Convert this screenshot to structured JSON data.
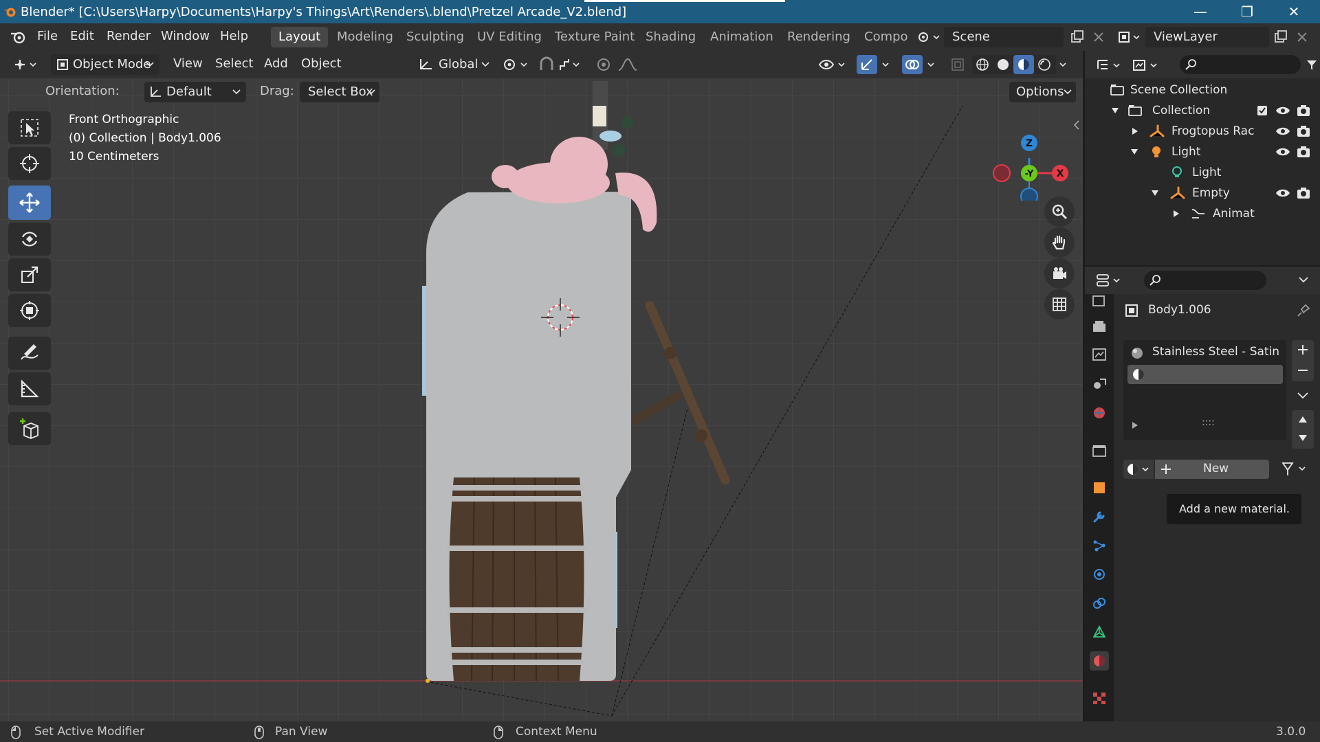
{
  "window": {
    "title": "Blender* [C:\\Users\\Harpy\\Documents\\Harpy's Things\\Art\\Renders\\.blend\\Pretzel Arcade_V2.blend]",
    "minimize": "—",
    "maximize": "❐",
    "close": "✕"
  },
  "menu": {
    "items": [
      "File",
      "Edit",
      "Render",
      "Window",
      "Help"
    ],
    "workspaces": [
      "Layout",
      "Modeling",
      "Sculpting",
      "UV Editing",
      "Texture Paint",
      "Shading",
      "Animation",
      "Rendering",
      "Compo"
    ],
    "active_workspace": "Layout",
    "scene": "Scene",
    "view_layer": "ViewLayer"
  },
  "viewport": {
    "mode": "Object Mode",
    "menus": [
      "View",
      "Select",
      "Add",
      "Object"
    ],
    "transform_orientation": "Global",
    "orientation_label": "Orientation:",
    "orientation_value": "Default",
    "drag_label": "Drag:",
    "drag_value": "Select Box",
    "options": "Options",
    "overlay_view": "Front Orthographic",
    "overlay_object": "(0) Collection | Body1.006",
    "overlay_scale": "10 Centimeters",
    "gizmo": {
      "z": "Z",
      "y": "-Y",
      "x": "X"
    }
  },
  "outliner": {
    "root": "Scene Collection",
    "rows": [
      {
        "label": "Collection",
        "level": 1,
        "expanded": true,
        "icon": "collection-icon"
      },
      {
        "label": "Frogtopus Rac",
        "level": 2,
        "expanded": false,
        "icon": "armature-icon"
      },
      {
        "label": "Light",
        "level": 2,
        "expanded": true,
        "icon": "light-object-icon"
      },
      {
        "label": "Light",
        "level": 3,
        "icon": "light-data-icon"
      },
      {
        "label": "Empty",
        "level": 3,
        "expanded": true,
        "icon": "empty-icon"
      },
      {
        "label": "Animat",
        "level": 4,
        "expanded": false,
        "icon": "animation-icon"
      }
    ]
  },
  "properties": {
    "object_name": "Body1.006",
    "material_slot": "Stainless Steel - Satin",
    "new_button": "New",
    "tooltip": "Add a new material.",
    "drag_handle": "::::"
  },
  "status": {
    "left": "Set Active Modifier",
    "middle": "Pan View",
    "right": "Context Menu",
    "version": "3.0.0"
  },
  "colors": {
    "title_bar": "#1e5c82",
    "active_tool": "#4772b3",
    "x_axis": "#e63946",
    "y_axis": "#6ac91a",
    "z_axis": "#2f86d6"
  }
}
